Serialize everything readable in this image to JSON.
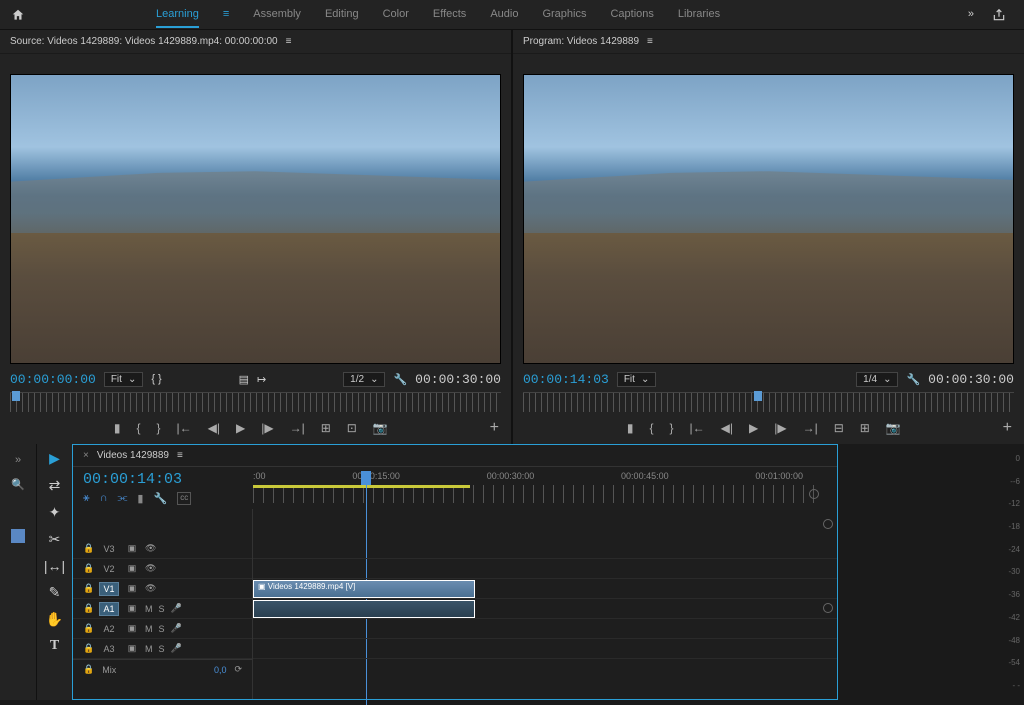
{
  "topbar": {
    "workspaces": [
      "Learning",
      "Assembly",
      "Editing",
      "Color",
      "Effects",
      "Audio",
      "Graphics",
      "Captions",
      "Libraries"
    ],
    "active_workspace": "Learning"
  },
  "source_monitor": {
    "title": "Source: Videos 1429889: Videos 1429889.mp4: 00:00:00:00",
    "timecode": "00:00:00:00",
    "fit_label": "Fit",
    "zoom_label": "1/2",
    "duration": "00:00:30:00"
  },
  "program_monitor": {
    "title": "Program: Videos 1429889",
    "timecode": "00:00:14:03",
    "fit_label": "Fit",
    "zoom_label": "1/4",
    "duration": "00:00:30:00"
  },
  "timeline": {
    "sequence_name": "Videos 1429889",
    "timecode": "00:00:14:03",
    "ruler_labels": [
      ":00",
      "00:00:15:00",
      "00:00:30:00",
      "00:00:45:00",
      "00:01:00:00"
    ],
    "playhead_percent": 19,
    "work_start_percent": 0,
    "work_end_percent": 38,
    "video_tracks": [
      {
        "name": "V3",
        "targeted": false
      },
      {
        "name": "V2",
        "targeted": false
      },
      {
        "name": "V1",
        "targeted": true
      }
    ],
    "audio_tracks": [
      {
        "name": "A1",
        "targeted": true,
        "mute": "M",
        "solo": "S"
      },
      {
        "name": "A2",
        "targeted": false,
        "mute": "M",
        "solo": "S"
      },
      {
        "name": "A3",
        "targeted": false,
        "mute": "M",
        "solo": "S"
      }
    ],
    "clip_v1": {
      "name": "Videos 1429889.mp4 [V]",
      "start_percent": 0,
      "width_percent": 38
    },
    "clip_a1": {
      "start_percent": 0,
      "width_percent": 38
    },
    "mix_label": "Mix",
    "mix_value": "0,0"
  },
  "audio_meter": {
    "scale": [
      "0",
      "--6",
      "-12",
      "-18",
      "-24",
      "-30",
      "-36",
      "-42",
      "-48",
      "-54",
      "- -"
    ]
  },
  "swatches": [
    "#3fbf3f",
    "#5a88c4"
  ]
}
